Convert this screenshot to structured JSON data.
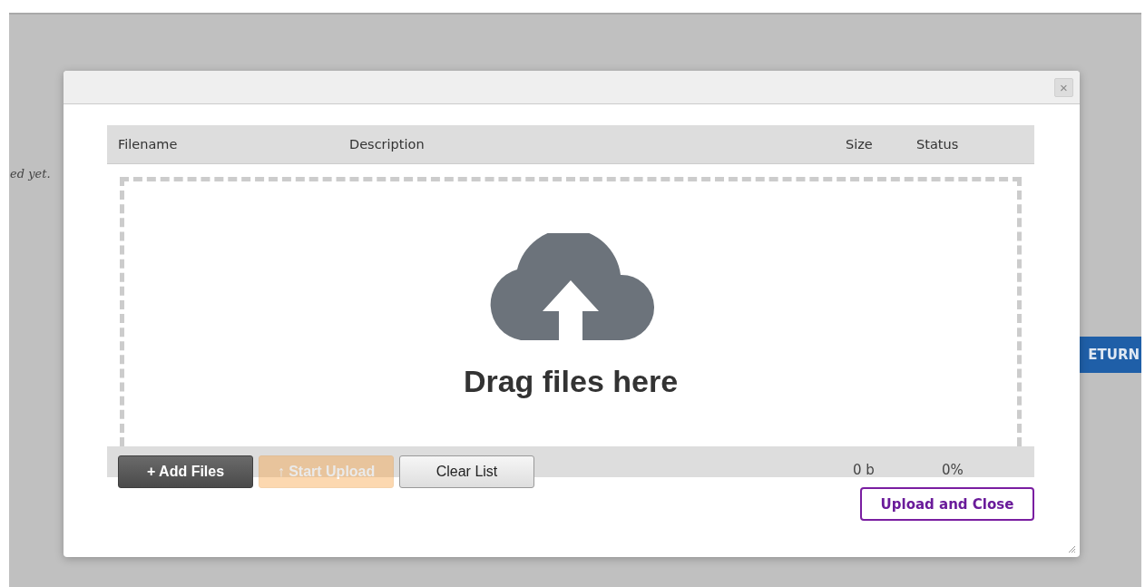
{
  "page": {
    "note": "ed yet.",
    "return_button": "ETURN"
  },
  "dialog": {
    "columns": [
      "Filename",
      "Description",
      "Size",
      "Status"
    ],
    "dropzone_text": "Drag files here",
    "buttons": [
      {
        "label": "+ Add Files",
        "kind": "dark",
        "disabled": false
      },
      {
        "label": "↑ Start Upload",
        "kind": "warning",
        "disabled": true
      },
      {
        "label": "Clear List",
        "kind": "default",
        "disabled": false
      }
    ],
    "total_size": "0 b",
    "total_status": "0%",
    "upload_close": "Upload and Close",
    "close": "×"
  }
}
